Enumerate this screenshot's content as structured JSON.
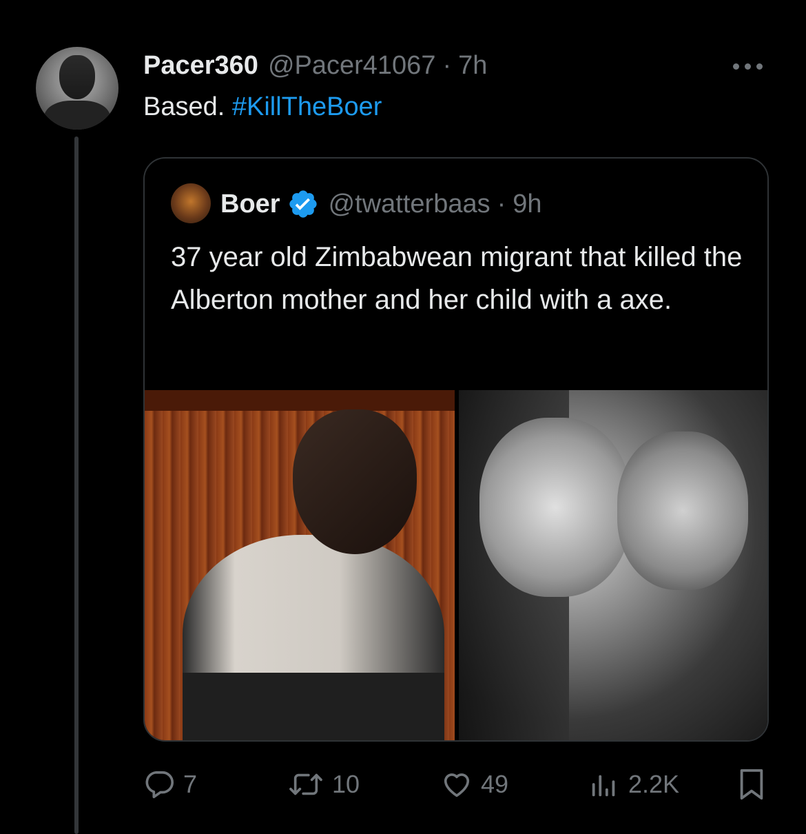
{
  "tweet": {
    "display_name": "Pacer360",
    "handle": "@Pacer41067",
    "separator": "·",
    "time": "7h",
    "text": "Based.",
    "hashtag": "#KillTheBoer"
  },
  "quoted_tweet": {
    "display_name": "Boer",
    "handle": "@twatterbaas",
    "separator": "·",
    "time": "9h",
    "text": "37 year old Zimbabwean migrant that killed the Alberton mother and her child with a axe."
  },
  "actions": {
    "replies": "7",
    "retweets": "10",
    "likes": "49",
    "views": "2.2K"
  },
  "colors": {
    "background": "#000000",
    "text_primary": "#e7e9ea",
    "text_secondary": "#71767b",
    "accent": "#1d9bf0",
    "border": "#2f3336"
  }
}
